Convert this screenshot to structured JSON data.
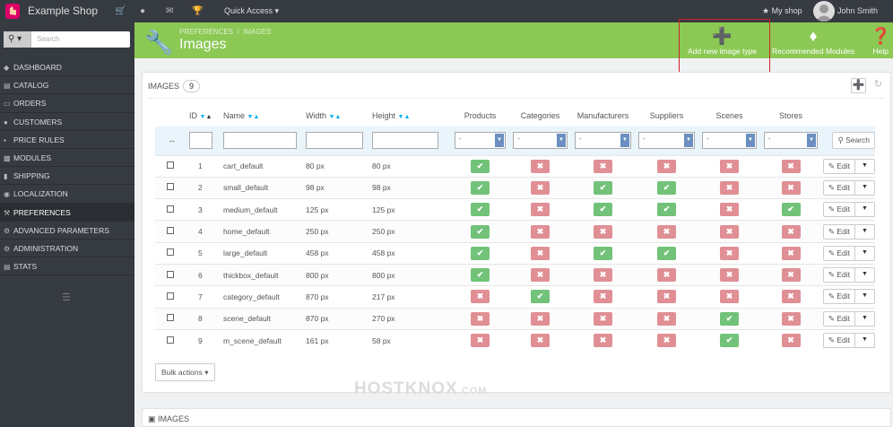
{
  "topbar": {
    "shop_name": "Example Shop",
    "quick_access": "Quick Access",
    "my_shop": "My shop",
    "user_name": "John Smith"
  },
  "sidebar": {
    "search_placeholder": "Search",
    "items": [
      {
        "label": "Dashboard",
        "icon": "dashboard-icon"
      },
      {
        "label": "Catalog",
        "icon": "catalog-icon"
      },
      {
        "label": "Orders",
        "icon": "orders-icon"
      },
      {
        "label": "Customers",
        "icon": "customers-icon"
      },
      {
        "label": "Price Rules",
        "icon": "price-rules-icon"
      },
      {
        "label": "Modules",
        "icon": "modules-icon"
      },
      {
        "label": "Shipping",
        "icon": "shipping-icon"
      },
      {
        "label": "Localization",
        "icon": "localization-icon"
      },
      {
        "label": "Preferences",
        "icon": "preferences-icon",
        "active": true
      },
      {
        "label": "Advanced Parameters",
        "icon": "advanced-parameters-icon"
      },
      {
        "label": "Administration",
        "icon": "administration-icon"
      },
      {
        "label": "Stats",
        "icon": "stats-icon"
      }
    ]
  },
  "header": {
    "breadcrumb_parent": "PREFERENCES",
    "breadcrumb_sep": "/",
    "breadcrumb_current": "IMAGES",
    "title": "Images",
    "add_new": "Add new image type",
    "recommended": "Recommended Modules",
    "help": "Help"
  },
  "panel": {
    "title": "IMAGES",
    "count": "9",
    "columns": {
      "id": "ID",
      "name": "Name",
      "width": "Width",
      "height": "Height",
      "products": "Products",
      "categories": "Categories",
      "manufacturers": "Manufacturers",
      "suppliers": "Suppliers",
      "scenes": "Scenes",
      "stores": "Stores"
    },
    "filter_dash": "--",
    "select_value": "-",
    "search_label": "Search",
    "edit_label": "Edit",
    "bulk_label": "Bulk actions",
    "rows": [
      {
        "id": "1",
        "name": "cart_default",
        "width": "80 px",
        "height": "80 px",
        "flags": [
          true,
          false,
          false,
          false,
          false,
          false
        ]
      },
      {
        "id": "2",
        "name": "small_default",
        "width": "98 px",
        "height": "98 px",
        "flags": [
          true,
          false,
          true,
          true,
          false,
          false
        ]
      },
      {
        "id": "3",
        "name": "medium_default",
        "width": "125 px",
        "height": "125 px",
        "flags": [
          true,
          false,
          true,
          true,
          false,
          true
        ]
      },
      {
        "id": "4",
        "name": "home_default",
        "width": "250 px",
        "height": "250 px",
        "flags": [
          true,
          false,
          false,
          false,
          false,
          false
        ]
      },
      {
        "id": "5",
        "name": "large_default",
        "width": "458 px",
        "height": "458 px",
        "flags": [
          true,
          false,
          true,
          true,
          false,
          false
        ]
      },
      {
        "id": "6",
        "name": "thickbox_default",
        "width": "800 px",
        "height": "800 px",
        "flags": [
          true,
          false,
          false,
          false,
          false,
          false
        ]
      },
      {
        "id": "7",
        "name": "category_default",
        "width": "870 px",
        "height": "217 px",
        "flags": [
          false,
          true,
          false,
          false,
          false,
          false
        ]
      },
      {
        "id": "8",
        "name": "scene_default",
        "width": "870 px",
        "height": "270 px",
        "flags": [
          false,
          false,
          false,
          false,
          true,
          false
        ]
      },
      {
        "id": "9",
        "name": "m_scene_default",
        "width": "161 px",
        "height": "58 px",
        "flags": [
          false,
          false,
          false,
          false,
          true,
          false
        ]
      }
    ]
  },
  "watermark": "HOSTKNOX",
  "watermark_suffix": ".COM",
  "panel2": {
    "title": "IMAGES"
  }
}
